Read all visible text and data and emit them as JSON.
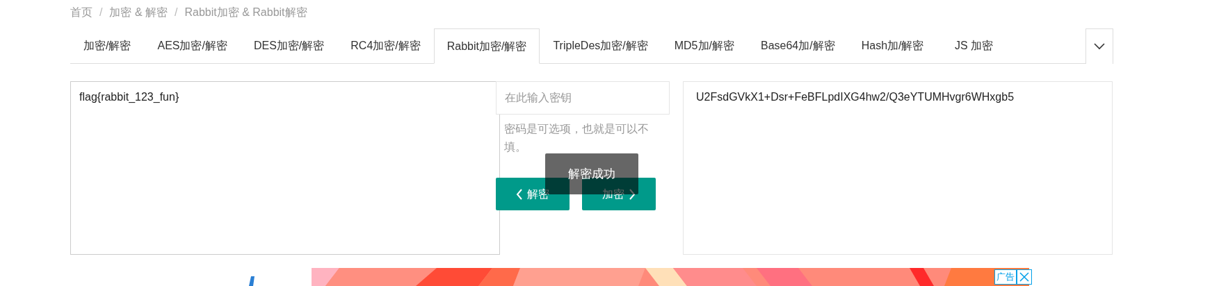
{
  "breadcrumb": [
    {
      "kind": "link",
      "text": "首页"
    },
    {
      "kind": "separator",
      "text": "/"
    },
    {
      "kind": "link",
      "text": "加密 & 解密"
    },
    {
      "kind": "separator",
      "text": "/"
    },
    {
      "kind": "link",
      "text": "Rabbit加密 & Rabbit解密"
    }
  ],
  "tabs": [
    {
      "label": "加密/解密",
      "selected": false
    },
    {
      "label": "AES加密/解密",
      "selected": false
    },
    {
      "label": "DES加密/解密",
      "selected": false
    },
    {
      "label": "RC4加密/解密",
      "selected": false
    },
    {
      "label": "Rabbit加密/解密",
      "selected": true
    },
    {
      "label": "TripleDes加密/解密",
      "selected": false
    },
    {
      "label": "MD5加/解密",
      "selected": false
    },
    {
      "label": "Base64加/解密",
      "selected": false
    },
    {
      "label": "Hash加/解密",
      "selected": false
    },
    {
      "label": "JS 加密",
      "selected": false
    }
  ],
  "input_text": "flag{rabbit_123_fun}",
  "key_field": {
    "placeholder": "在此输入密钥"
  },
  "key_hint": "密码是可选项，也就是可以不填。",
  "buttons": [
    {
      "kind": "decrypt",
      "label": "解密"
    },
    {
      "kind": "encrypt",
      "label": "加密"
    }
  ],
  "toast": "解密成功",
  "output_text": "U2FsdGVkX1+Dsr+FeBFLpdIXG4hw2/Q3eYTUMHvgr6WHxgb5",
  "ad": {
    "label": "广告"
  }
}
